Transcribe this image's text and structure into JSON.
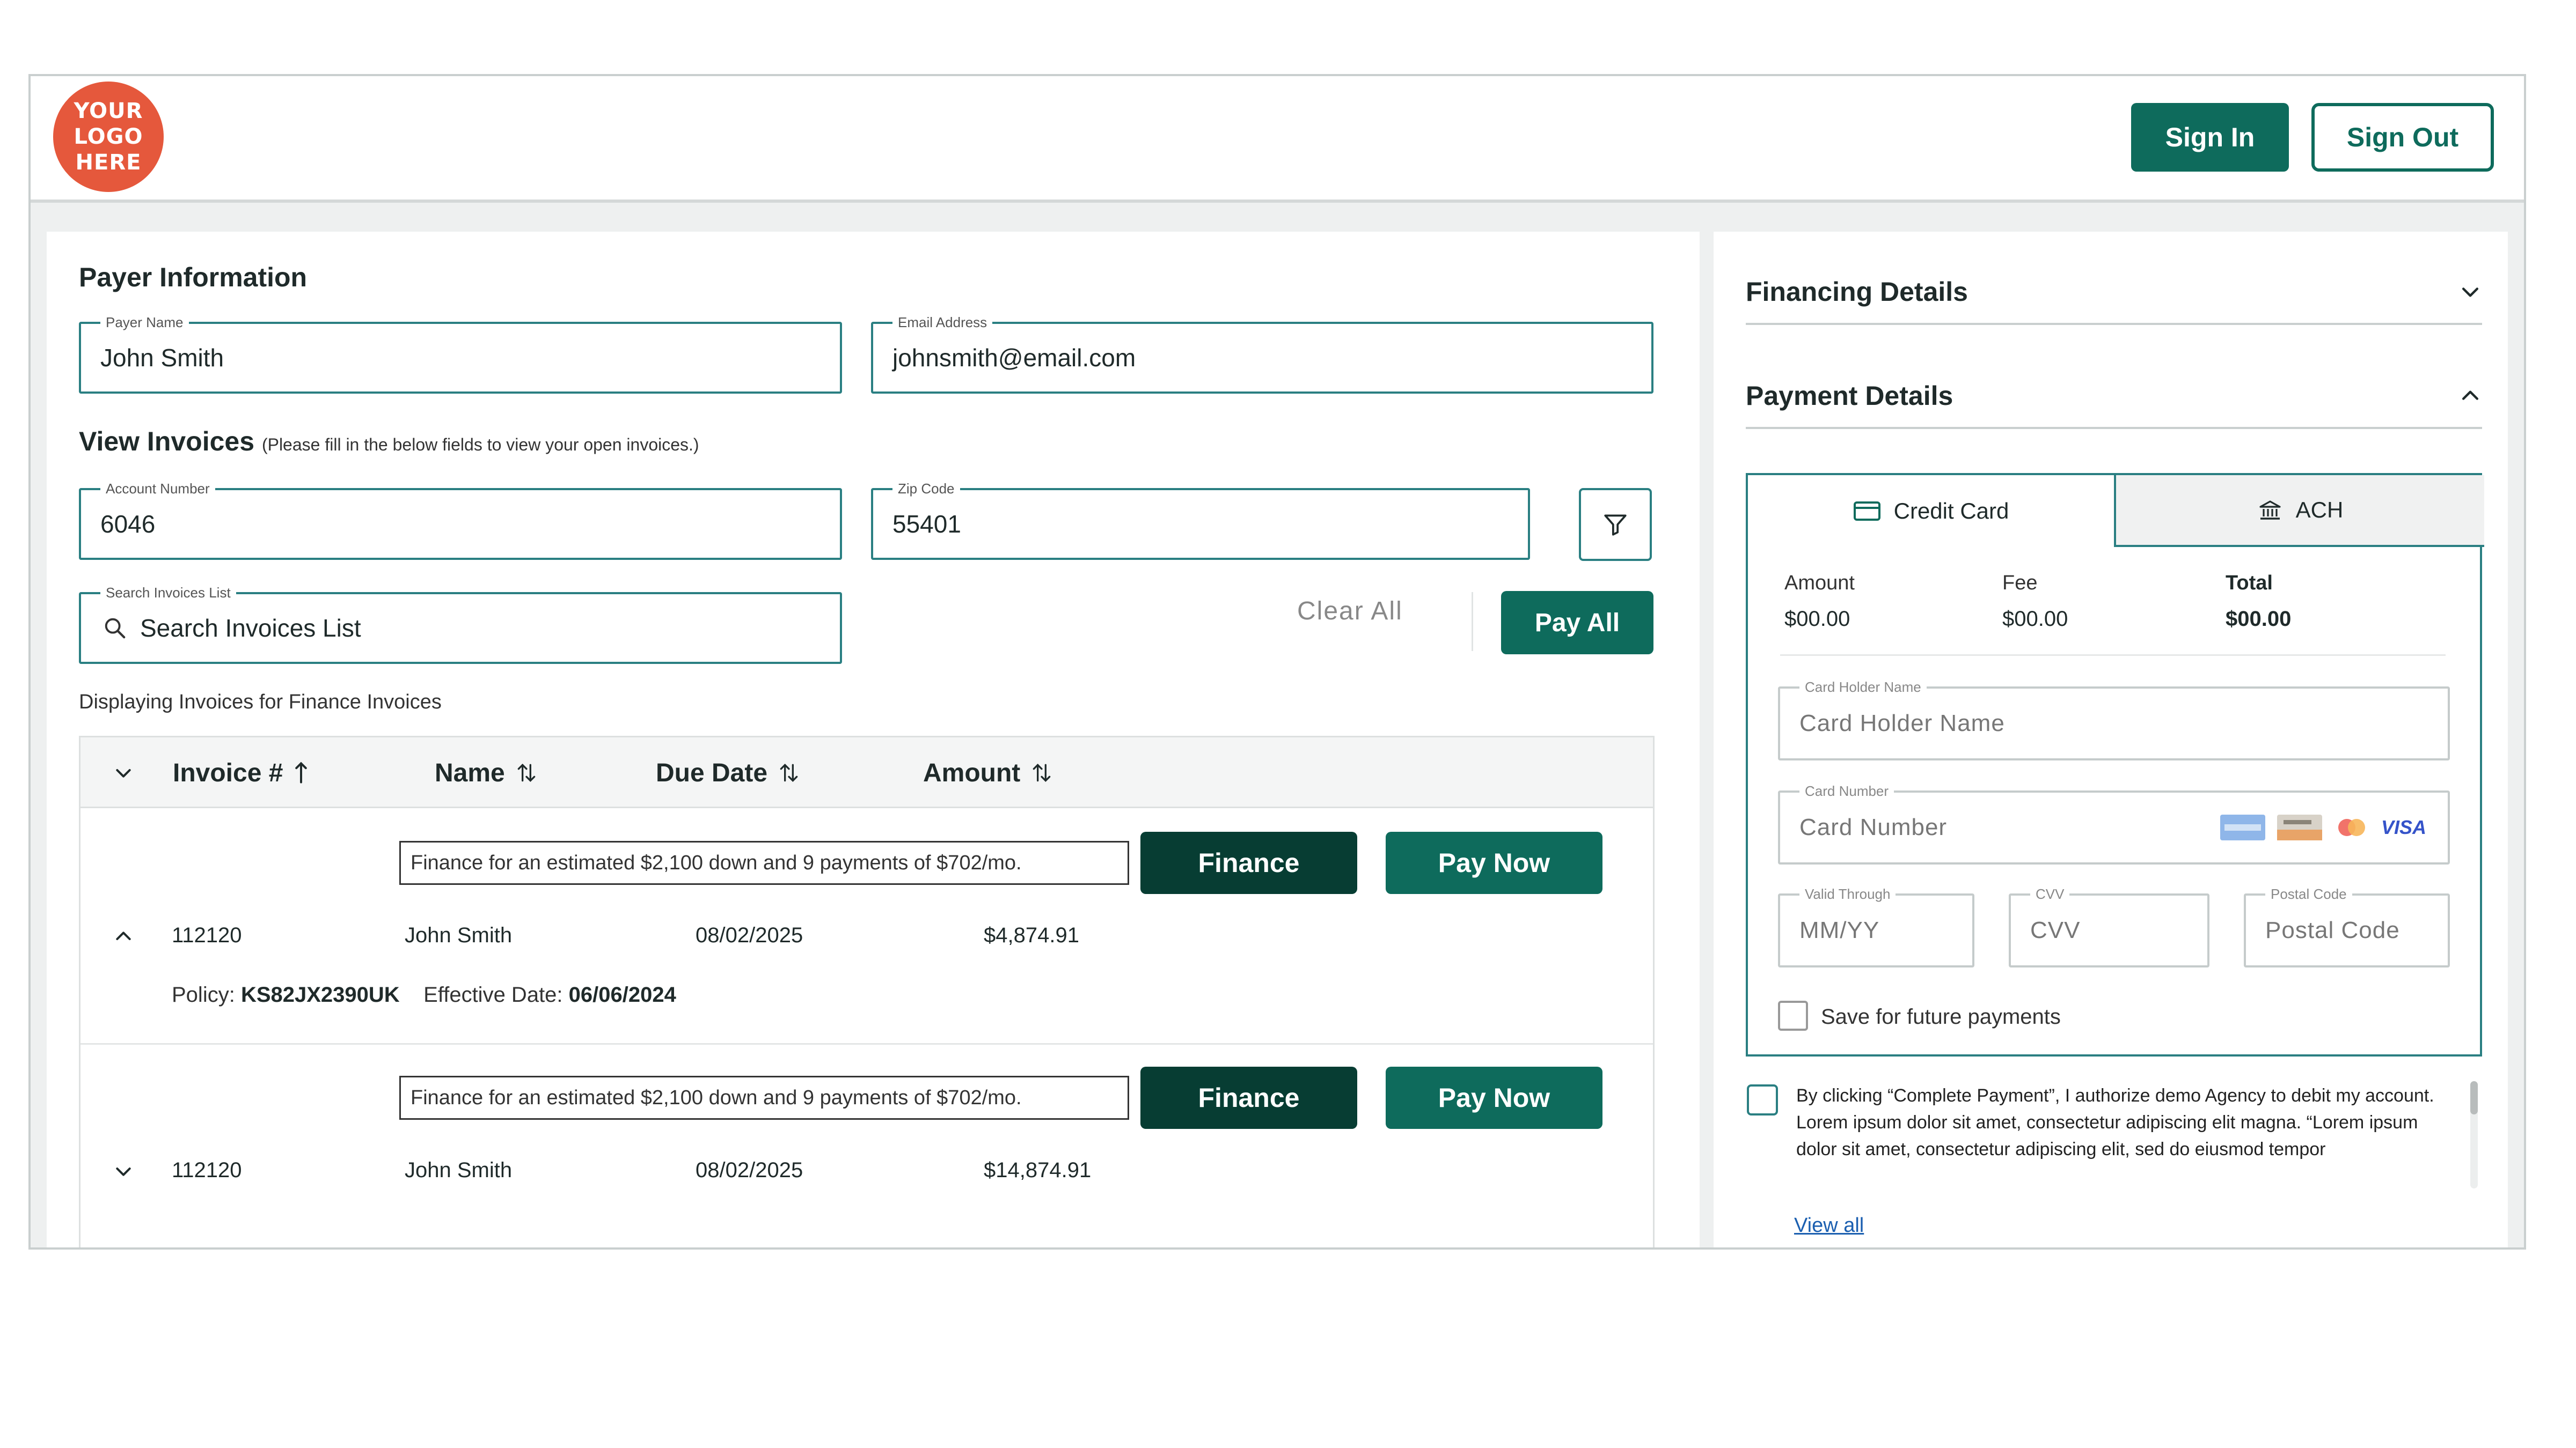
{
  "header": {
    "logo_lines": [
      "YOUR",
      "LOGO",
      "HERE"
    ],
    "sign_in": "Sign In",
    "sign_out": "Sign Out"
  },
  "payer": {
    "title": "Payer Information",
    "name_label": "Payer Name",
    "name_value": "John Smith",
    "email_label": "Email Address",
    "email_value": "johnsmith@email.com"
  },
  "view_invoices": {
    "title": "View Invoices",
    "hint": "(Please fill in the below fields to view your open invoices.)",
    "account_label": "Account Number",
    "account_value": "6046",
    "zip_label": "Zip Code",
    "zip_value": "55401",
    "search_label": "Search Invoices List",
    "search_placeholder": "Search Invoices List",
    "clear_all": "Clear All",
    "pay_all": "Pay All",
    "displaying": "Displaying Invoices for Finance Invoices"
  },
  "table": {
    "headers": [
      "Invoice #",
      "Name",
      "Due Date",
      "Amount"
    ],
    "rows": [
      {
        "finance_note": "Finance for an estimated $2,100 down and 9 payments of $702/mo.",
        "finance_btn": "Finance",
        "pay_btn": "Pay Now",
        "invoice": "112120",
        "name": "John Smith",
        "due_date": "08/02/2025",
        "amount": "$4,874.91",
        "policy_label": "Policy:",
        "policy_value": "KS82JX2390UK",
        "effective_label": "Effective Date:",
        "effective_value": "06/06/2024"
      },
      {
        "finance_note": "Finance for an estimated $2,100 down and 9 payments of $702/mo.",
        "finance_btn": "Finance",
        "pay_btn": "Pay Now",
        "invoice": "112120",
        "name": "John Smith",
        "due_date": "08/02/2025",
        "amount": "$14,874.91"
      }
    ]
  },
  "right": {
    "financing_title": "Financing Details",
    "payment_title": "Payment Details",
    "tabs": [
      "Credit Card",
      "ACH"
    ],
    "summary": {
      "amount_label": "Amount",
      "amount_value": "$00.00",
      "fee_label": "Fee",
      "fee_value": "$00.00",
      "total_label": "Total",
      "total_value": "$00.00"
    },
    "card_holder_label": "Card Holder Name",
    "card_holder_placeholder": "Card Holder Name",
    "card_number_label": "Card Number",
    "card_number_placeholder": "Card Number",
    "valid_label": "Valid Through",
    "valid_placeholder": "MM/YY",
    "cvv_label": "CVV",
    "cvv_placeholder": "CVV",
    "postal_label": "Postal Code",
    "postal_placeholder": "Postal Code",
    "visa_text": "VISA",
    "save_label": "Save for future payments",
    "consent": "By clicking “Complete Payment”, I authorize demo Agency to debit my account. Lorem ipsum dolor sit amet, consectetur adipiscing elit magna. “Lorem ipsum dolor sit amet, consectetur adipiscing elit, sed do eiusmod tempor",
    "view_all": "View all"
  },
  "colors": {
    "primary": "#0e6b5c",
    "dark_primary": "#073d33",
    "field_border": "#2a7f82",
    "logo": "#e5583c",
    "link": "#1b5fb0"
  }
}
